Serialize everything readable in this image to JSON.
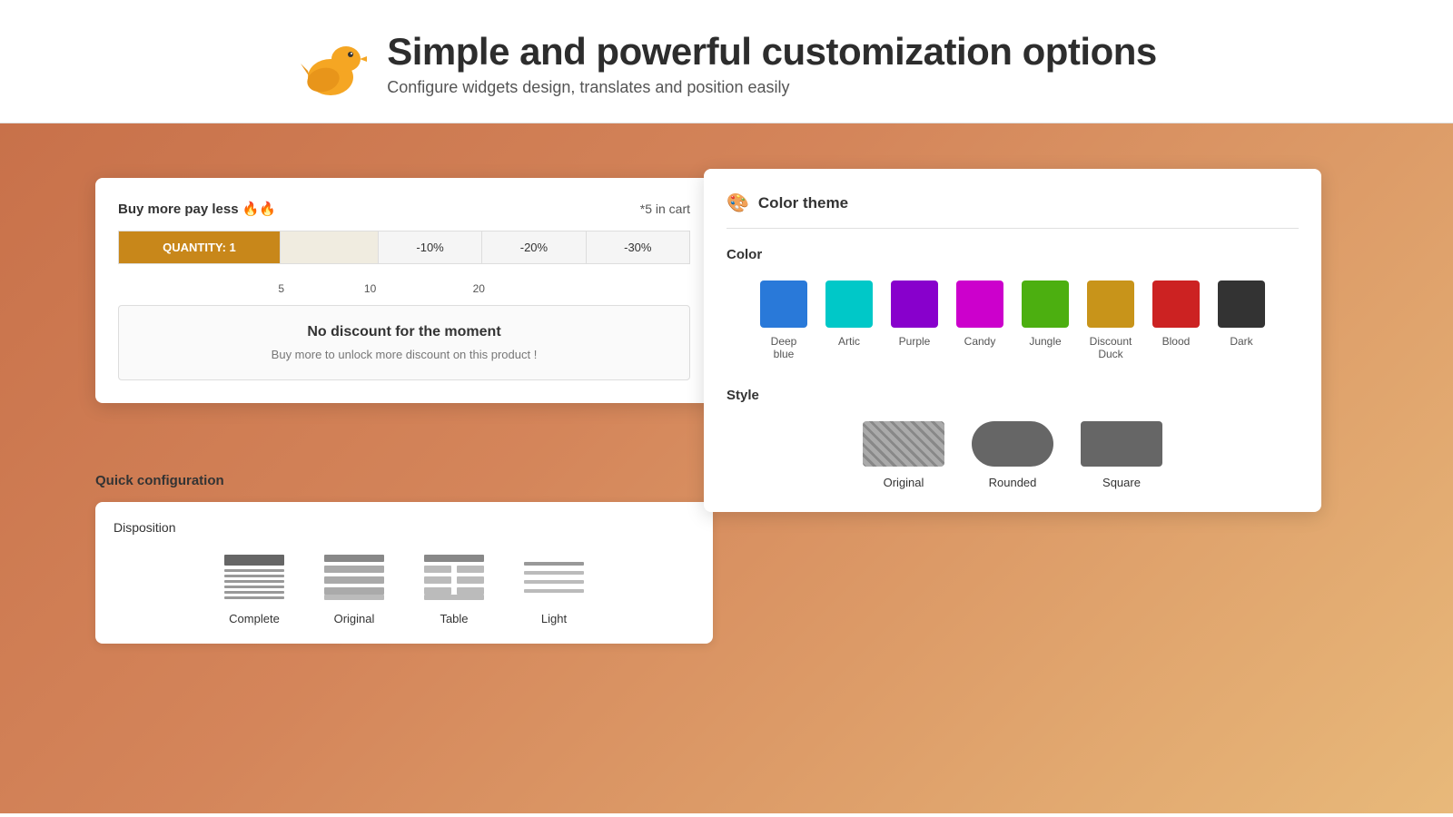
{
  "header": {
    "title": "Simple and powerful customization options",
    "subtitle": "Configure widgets design, translates and position easily"
  },
  "widget": {
    "buy_more_label": "Buy more pay less 🔥🔥",
    "cart_label": "*5 in cart",
    "quantity_label": "QUANTITY: 1",
    "discounts": [
      "-10%",
      "-20%",
      "-30%"
    ],
    "milestones": [
      "5",
      "10",
      "20"
    ],
    "no_discount_title": "No discount for the moment",
    "no_discount_subtitle": "Buy more to unlock more discount on this product !"
  },
  "quick_config": {
    "title": "Quick configuration",
    "disposition": {
      "label": "Disposition",
      "options": [
        "Complete",
        "Original",
        "Table",
        "Light"
      ]
    }
  },
  "color_theme": {
    "panel_title": "Color theme",
    "color_section_label": "Color",
    "style_section_label": "Style",
    "colors": [
      {
        "name": "Deep blue",
        "hex": "#2979d9"
      },
      {
        "name": "Artic",
        "hex": "#00c8c8"
      },
      {
        "name": "Purple",
        "hex": "#8800cc"
      },
      {
        "name": "Candy",
        "hex": "#cc00cc"
      },
      {
        "name": "Jungle",
        "hex": "#4caf10"
      },
      {
        "name": "Discount Duck",
        "hex": "#c8941a"
      },
      {
        "name": "Blood",
        "hex": "#cc2222"
      },
      {
        "name": "Dark",
        "hex": "#333333"
      }
    ],
    "styles": [
      {
        "name": "Original",
        "type": "original"
      },
      {
        "name": "Rounded",
        "type": "rounded"
      },
      {
        "name": "Square",
        "type": "square"
      }
    ]
  }
}
